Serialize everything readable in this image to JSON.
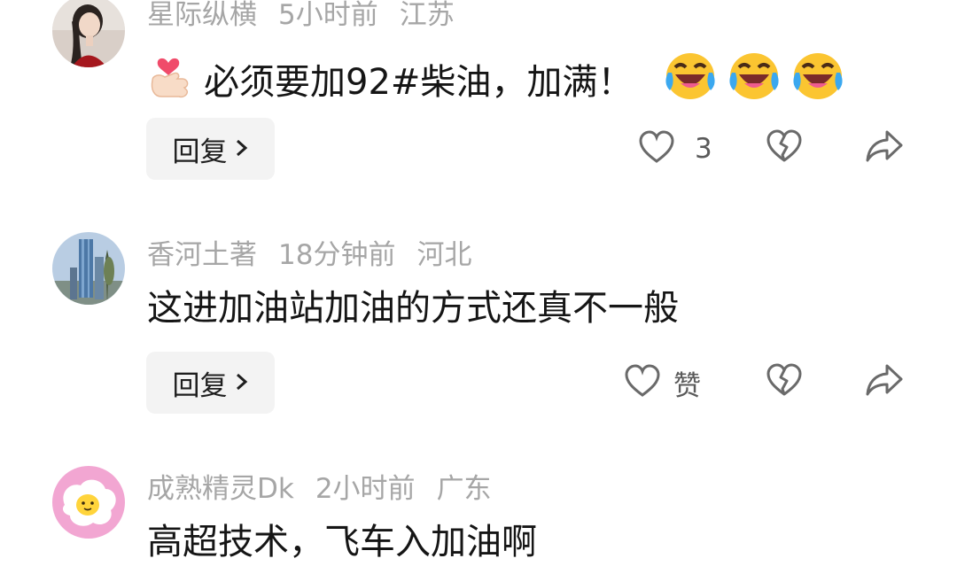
{
  "comments": [
    {
      "username": "星际纵横",
      "time": "5小时前",
      "location": "江苏",
      "text": "必须要加92#柴油，加满！",
      "reply_label": "回复",
      "likes": "3",
      "avatar_icon": "user-photo-woman-icon",
      "leading_emoji": "finger-heart-icon",
      "trailing_emoji": "laughing-crying-face-icon"
    },
    {
      "username": "香河土著",
      "time": "18分钟前",
      "location": "河北",
      "text": "这进加油站加油的方式还真不一般",
      "reply_label": "回复",
      "likes": "赞",
      "avatar_icon": "tower-building-photo-icon"
    },
    {
      "username": "成熟精灵Dk",
      "time": "2小时前",
      "location": "广东",
      "text": "高超技术，飞车入加油啊",
      "avatar_icon": "fried-egg-avatar-icon"
    }
  ],
  "colors": {
    "meta_text": "#a6a6a6",
    "body_text": "#151515",
    "button_bg": "#f3f3f3"
  }
}
